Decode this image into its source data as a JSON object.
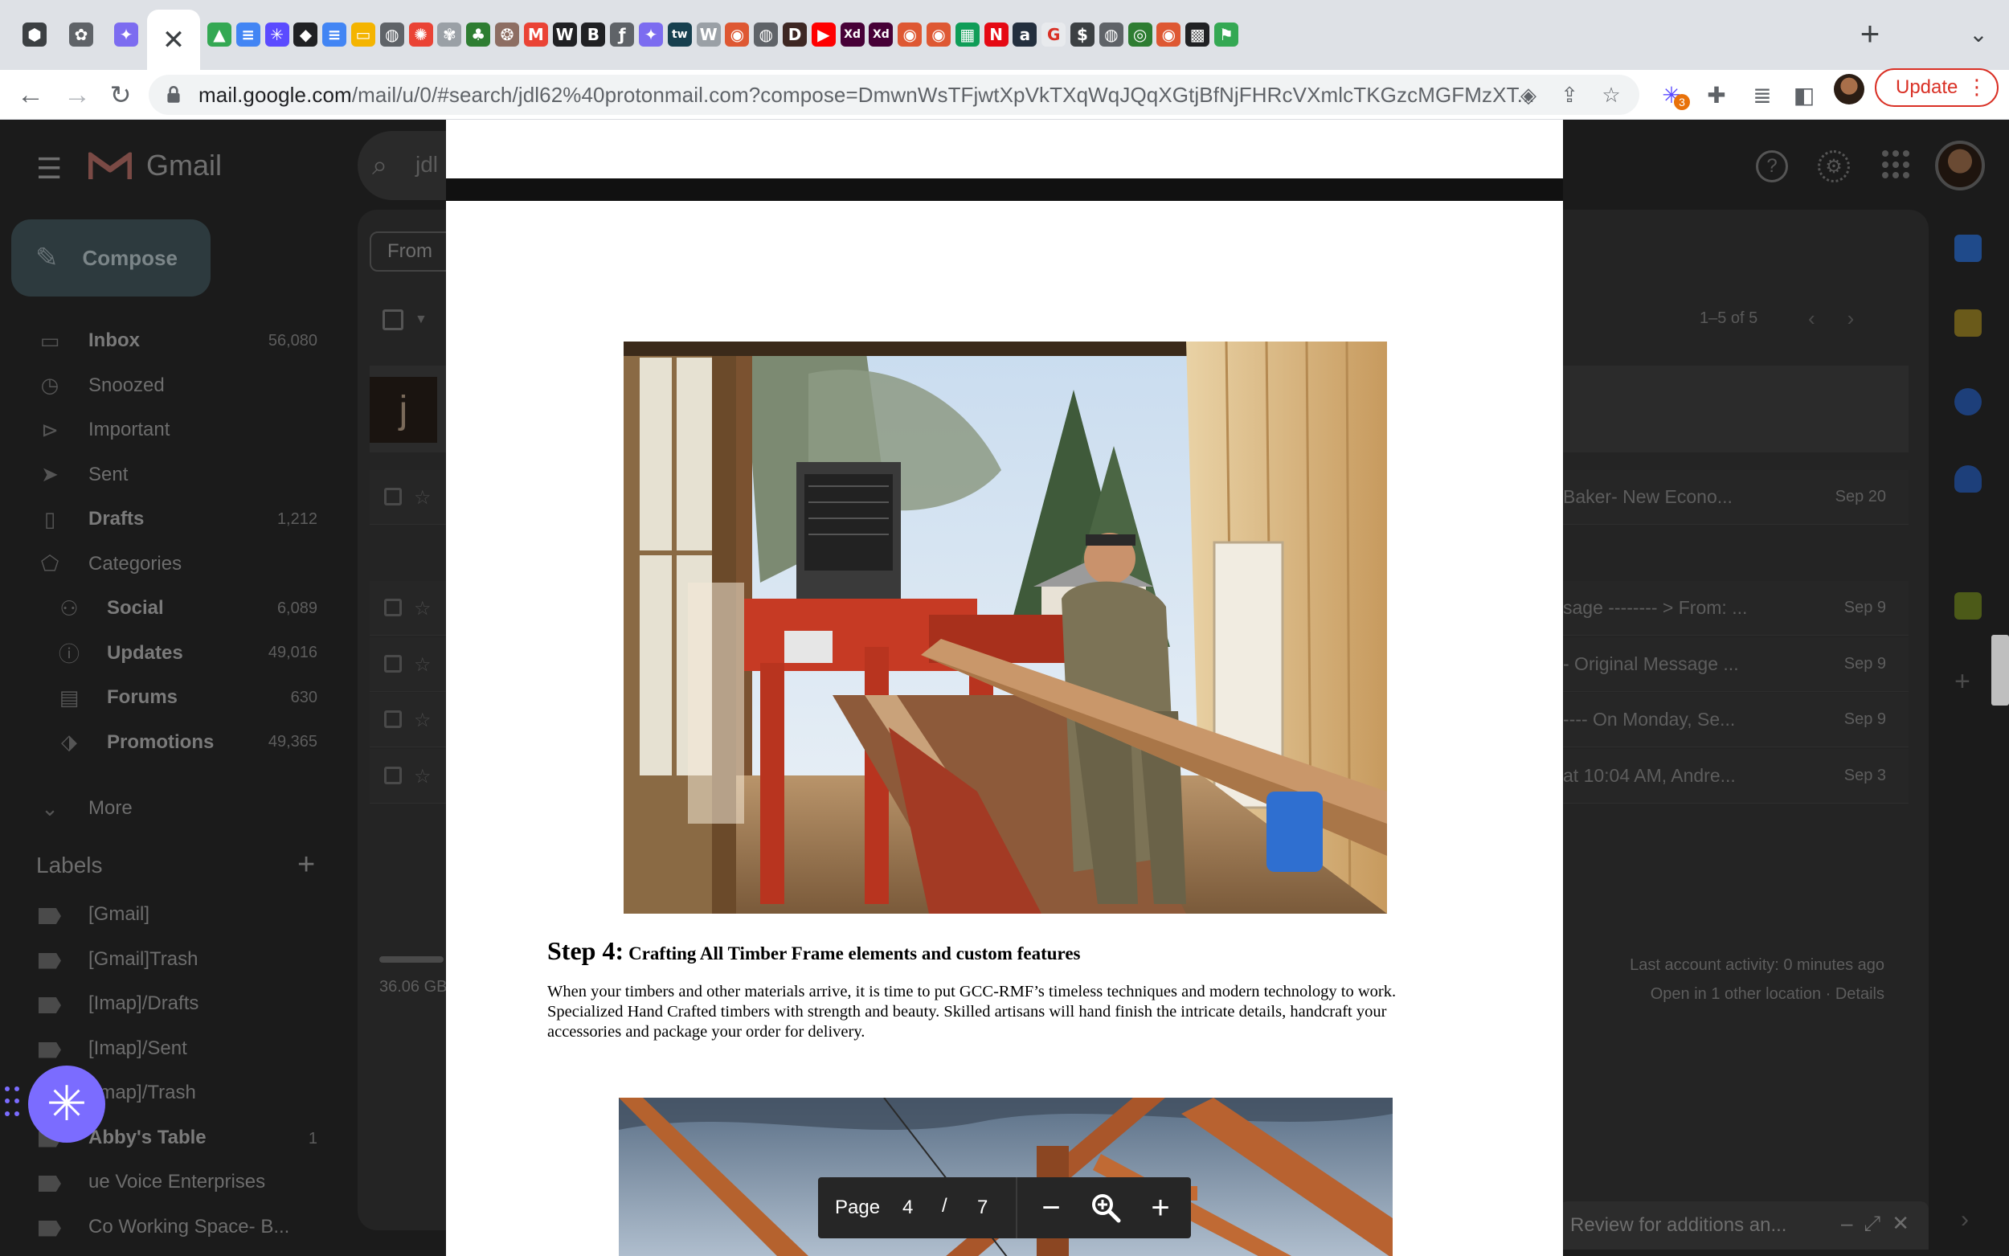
{
  "browser": {
    "close_tab_glyph": "✕",
    "new_tab_glyph": "+",
    "url_host": "mail.google.com",
    "url_path": "/mail/u/0/#search/jdl62%40protonmail.com?compose=DmwnWsTFjwtXpVkTXqWqJQqXGtjBfNjFHRcVXmlcTKGzcMGFMzXT...",
    "extension_badge": "3",
    "update_label": "Update",
    "tab_favicons": [
      {
        "icon": "cube-icon",
        "glyph": "⬢",
        "bg": "#3c4043"
      },
      {
        "icon": "openai-icon",
        "glyph": "✿",
        "bg": "#5f6368"
      },
      {
        "icon": "sparkle-icon",
        "glyph": "✦",
        "bg": "#7c6cf0"
      },
      {
        "icon": "drive-icon",
        "glyph": "▲",
        "bg": "#34a853"
      },
      {
        "icon": "docs-icon",
        "glyph": "≡",
        "bg": "#4285f4"
      },
      {
        "icon": "asana-icon",
        "glyph": "✳",
        "bg": "#5b4bff"
      },
      {
        "icon": "diamond-icon",
        "glyph": "◆",
        "bg": "#202124"
      },
      {
        "icon": "docs-icon",
        "glyph": "≡",
        "bg": "#4285f4"
      },
      {
        "icon": "slides-icon",
        "glyph": "▭",
        "bg": "#f4b400"
      },
      {
        "icon": "globe-icon",
        "glyph": "◍",
        "bg": "#5f6368"
      },
      {
        "icon": "photos-icon",
        "glyph": "✺",
        "bg": "#ea4335"
      },
      {
        "icon": "plant-icon",
        "glyph": "✾",
        "bg": "#9aa0a6"
      },
      {
        "icon": "tree-icon",
        "glyph": "♣",
        "bg": "#2e7d32"
      },
      {
        "icon": "shell-icon",
        "glyph": "❂",
        "bg": "#8d6e63"
      },
      {
        "icon": "gmail-icon",
        "glyph": "M",
        "bg": "#ea4335"
      },
      {
        "icon": "wikipedia-w-icon",
        "glyph": "W",
        "bg": "#202124"
      },
      {
        "icon": "bold-b-icon",
        "glyph": "B",
        "bg": "#202124"
      },
      {
        "icon": "script-f-icon",
        "glyph": "ƒ",
        "bg": "#5f6368"
      },
      {
        "icon": "sparkle-icon",
        "glyph": "✦",
        "bg": "#7c6cf0"
      },
      {
        "icon": "tw-icon",
        "glyph": "tw",
        "bg": "#17404f"
      },
      {
        "icon": "wikipedia-icon",
        "glyph": "W",
        "bg": "#9aa0a6"
      },
      {
        "icon": "duckduckgo-icon",
        "glyph": "◉",
        "bg": "#de5833"
      },
      {
        "icon": "globe-icon",
        "glyph": "◍",
        "bg": "#5f6368"
      },
      {
        "icon": "d-icon",
        "glyph": "D",
        "bg": "#3e2723"
      },
      {
        "icon": "youtube-icon",
        "glyph": "▶",
        "bg": "#ff0000"
      },
      {
        "icon": "xd-icon",
        "glyph": "Xd",
        "bg": "#470137"
      },
      {
        "icon": "xd-icon",
        "glyph": "Xd",
        "bg": "#470137"
      },
      {
        "icon": "duckduckgo-icon",
        "glyph": "◉",
        "bg": "#de5833"
      },
      {
        "icon": "duckduckgo-icon",
        "glyph": "◉",
        "bg": "#de5833"
      },
      {
        "icon": "sheets-icon",
        "glyph": "▦",
        "bg": "#0f9d58"
      },
      {
        "icon": "netflix-icon",
        "glyph": "N",
        "bg": "#e50914"
      },
      {
        "icon": "amazon-icon",
        "glyph": "a",
        "bg": "#232f3e"
      },
      {
        "icon": "grammarly-icon",
        "glyph": "G",
        "bg": "#e8eaed"
      },
      {
        "icon": "cash-icon",
        "glyph": "$",
        "bg": "#3c4043"
      },
      {
        "icon": "globe-icon",
        "glyph": "◍",
        "bg": "#5f6368"
      },
      {
        "icon": "circle-logo-icon",
        "glyph": "◎",
        "bg": "#2e7d32"
      },
      {
        "icon": "duckduckgo-icon",
        "glyph": "◉",
        "bg": "#de5833"
      },
      {
        "icon": "qr-icon",
        "glyph": "▩",
        "bg": "#202124"
      },
      {
        "icon": "flag-icon",
        "glyph": "⚑",
        "bg": "#34a853"
      }
    ]
  },
  "gmail": {
    "logo_text": "Gmail",
    "search_query": "jdl",
    "compose_label": "Compose",
    "nav": [
      {
        "label": "Inbox",
        "count": "56,080",
        "icon": "inbox-icon",
        "bold": true
      },
      {
        "label": "Snoozed",
        "count": "",
        "icon": "clock-icon",
        "bold": false
      },
      {
        "label": "Important",
        "count": "",
        "icon": "important-icon",
        "bold": false
      },
      {
        "label": "Sent",
        "count": "",
        "icon": "send-icon",
        "bold": false
      },
      {
        "label": "Drafts",
        "count": "1,212",
        "icon": "draft-icon",
        "bold": true
      },
      {
        "label": "Categories",
        "count": "",
        "icon": "label-icon",
        "bold": false
      }
    ],
    "categories": [
      {
        "label": "Social",
        "count": "6,089",
        "icon": "people-icon"
      },
      {
        "label": "Updates",
        "count": "49,016",
        "icon": "info-icon"
      },
      {
        "label": "Forums",
        "count": "630",
        "icon": "forum-icon"
      },
      {
        "label": "Promotions",
        "count": "49,365",
        "icon": "tag-icon"
      }
    ],
    "more_label": "More",
    "labels_heading": "Labels",
    "labels": [
      {
        "label": "[Gmail]",
        "count": "",
        "bold": false
      },
      {
        "label": "[Gmail]Trash",
        "count": "",
        "bold": false
      },
      {
        "label": "[Imap]/Drafts",
        "count": "",
        "bold": false
      },
      {
        "label": "[Imap]/Sent",
        "count": "",
        "bold": false
      },
      {
        "label": "[Imap]/Trash",
        "count": "",
        "bold": false
      },
      {
        "label": "Abby's Table",
        "count": "1",
        "bold": true
      },
      {
        "label": "ue Voice Enterprises",
        "count": "",
        "bold": false
      },
      {
        "label": "Co Working Space- B...",
        "count": "",
        "bold": false
      }
    ],
    "from_chip": "From",
    "pager": "1–5 of 5",
    "thread_avatar_letter": "j",
    "rows": [
      {
        "snippet": "Baker- New Econo...",
        "date": "Sep 20"
      },
      {
        "snippet": "sage -------- > From: ...",
        "date": "Sep 9"
      },
      {
        "snippet": "- Original Message ...",
        "date": "Sep 9"
      },
      {
        "snippet": "---- On Monday, Se...",
        "date": "Sep 9"
      },
      {
        "snippet": "at 10:04 AM, Andre...",
        "date": "Sep 3"
      }
    ],
    "storage": "36.06 GB",
    "activity_line1": "Last account activity: 0 minutes ago",
    "activity_line2": "Open in 1 other location · Details",
    "review_draft": "Review for additions an..."
  },
  "pdf": {
    "step_label": "Step 4:",
    "step_title": "Crafting All Timber Frame elements and custom features",
    "step_body": "When your timbers and other materials arrive, it is time to put GCC-RMF’s timeless techniques and modern technology to work. Specialized Hand Crafted timbers with strength and beauty. Skilled artisans will hand finish the intricate details, handcraft your accessories and package your order for delivery.",
    "page_label": "Page",
    "page_current": "4",
    "page_slash": "/",
    "page_total": "7"
  }
}
